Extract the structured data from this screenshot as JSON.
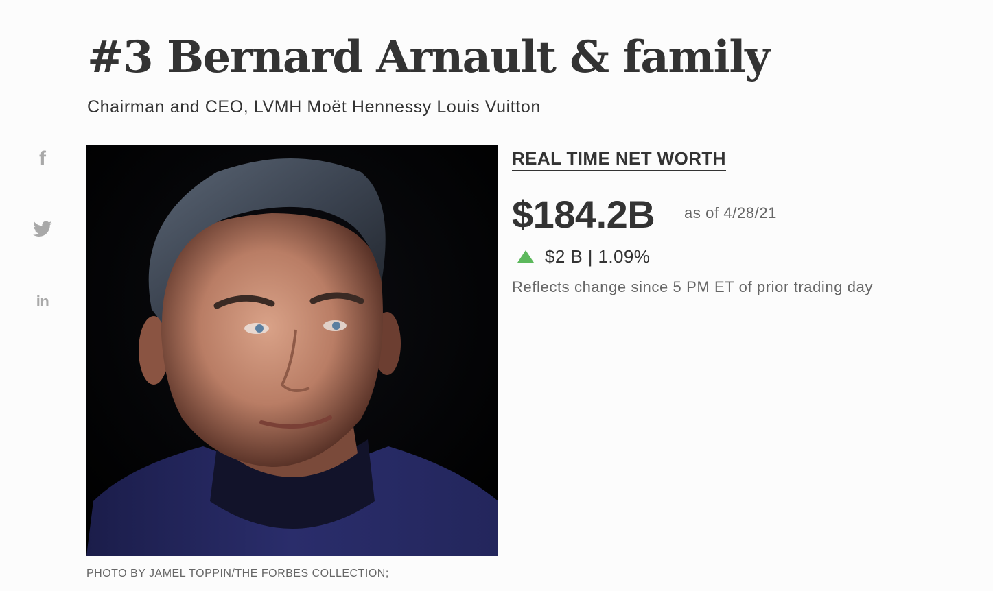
{
  "profile": {
    "title": "#3 Bernard Arnault & family",
    "subtitle": "Chairman and CEO, LVMH Moët Hennessy Louis Vuitton"
  },
  "share": {
    "items": [
      {
        "icon": "facebook-icon"
      },
      {
        "icon": "twitter-icon"
      },
      {
        "icon": "linkedin-icon"
      }
    ],
    "color": "#a9a9a9"
  },
  "photo": {
    "credit": "PHOTO BY JAMEL TOPPIN/THE FORBES COLLECTION;"
  },
  "net_worth": {
    "heading": "REAL TIME NET WORTH",
    "value": "$184.2B",
    "as_of": "as of 4/28/21",
    "direction": "up",
    "direction_color": "#5cb85c",
    "change": "$2 B | 1.09%",
    "note": "Reflects change since 5 PM ET of prior trading day"
  }
}
